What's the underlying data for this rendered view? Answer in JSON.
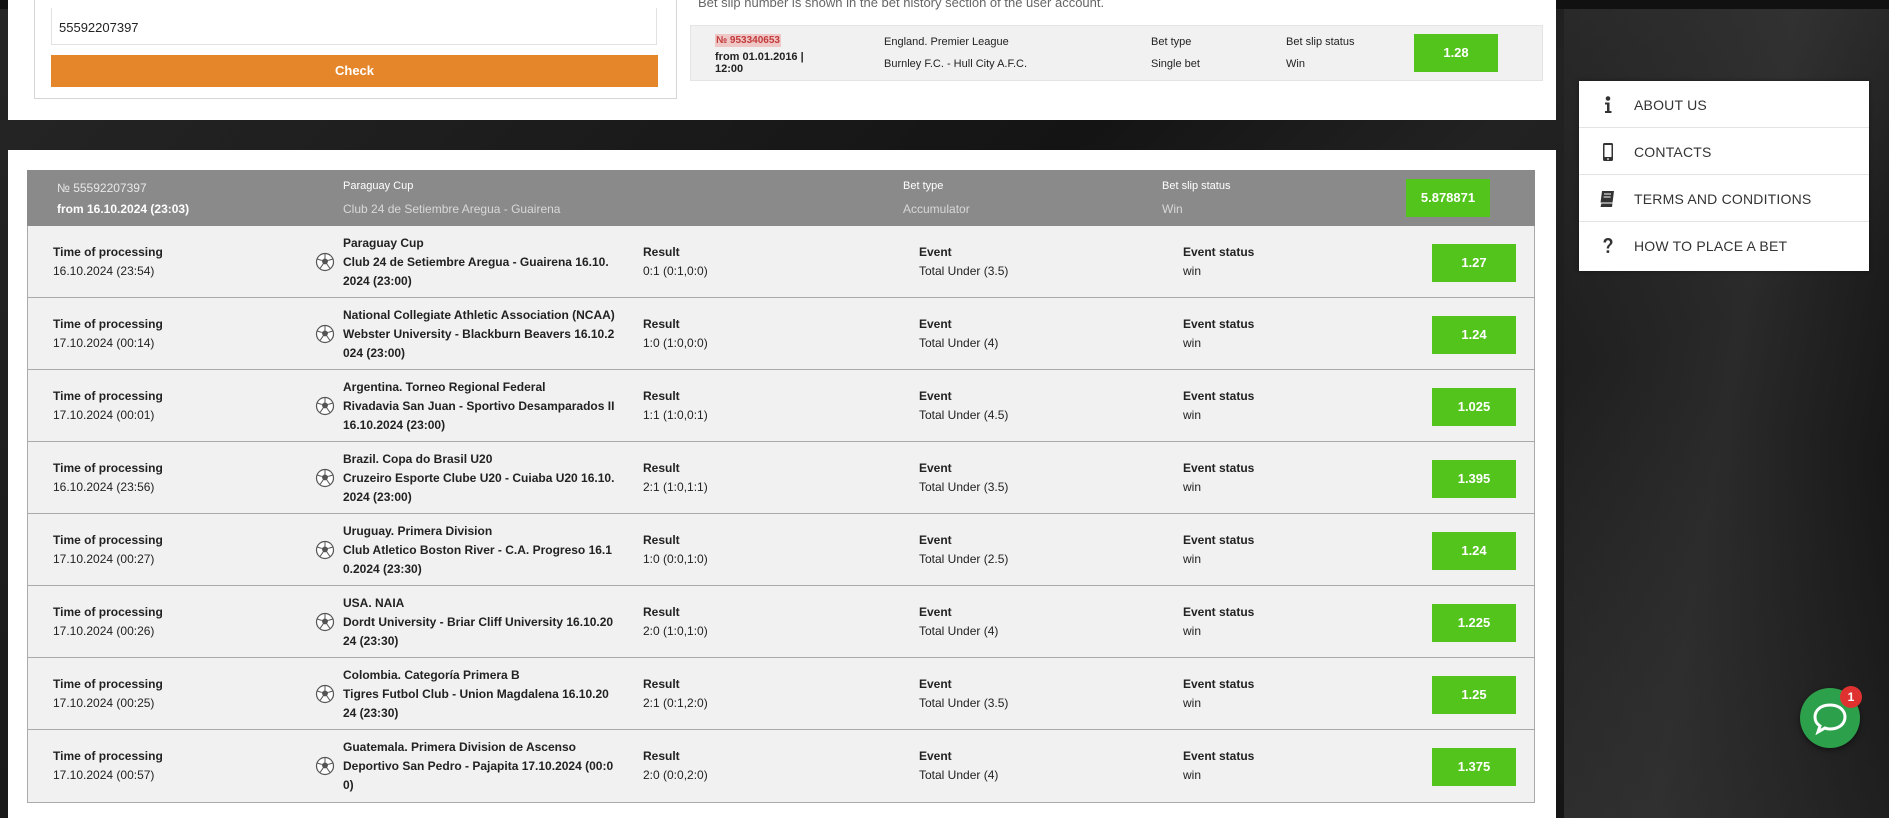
{
  "check": {
    "input_value": "55592207397",
    "button_label": "Check"
  },
  "hint": "Bet slip number is shown in the bet history section of the user account.",
  "prev_slip": {
    "number": "№ 953340653",
    "date": "from 01.01.2016 | 12:00",
    "league": "England. Premier League",
    "match": "Burnley F.C. - Hull City A.F.C.",
    "bet_type_label": "Bet type",
    "bet_type": "Single bet",
    "status_label": "Bet slip status",
    "status": "Win",
    "odds": "1.28"
  },
  "slip": {
    "number": "№ 55592207397",
    "date": "from 16.10.2024 (23:03)",
    "tournament": "Paraguay Cup",
    "match": "Club 24 de Setiembre Aregua - Guairena",
    "bet_type_label": "Bet type",
    "bet_type": "Accumulator",
    "status_label": "Bet slip status",
    "status": "Win",
    "odds": "5.878871"
  },
  "labels": {
    "time": "Time of processing",
    "result": "Result",
    "event": "Event",
    "event_status": "Event status"
  },
  "events": [
    {
      "time": "16.10.2024 (23:54)",
      "tournament": "Paraguay Cup",
      "match": "Club 24 de Setiembre Aregua - Guairena 16.10.2024 (23:00)",
      "result": "0:1 (0:1,0:0)",
      "event": "Total Under (3.5)",
      "status": "win",
      "odds": "1.27"
    },
    {
      "time": "17.10.2024 (00:14)",
      "tournament": "National Collegiate Athletic Association (NCAA)",
      "match": "Webster University - Blackburn Beavers 16.10.2024 (23:00)",
      "result": "1:0 (1:0,0:0)",
      "event": "Total Under (4)",
      "status": "win",
      "odds": "1.24"
    },
    {
      "time": "17.10.2024 (00:01)",
      "tournament": "Argentina. Torneo Regional Federal",
      "match": "Rivadavia San Juan - Sportivo Desamparados II 16.10.2024 (23:00)",
      "result": "1:1 (1:0,0:1)",
      "event": "Total Under (4.5)",
      "status": "win",
      "odds": "1.025"
    },
    {
      "time": "16.10.2024 (23:56)",
      "tournament": "Brazil. Copa do Brasil U20",
      "match": "Cruzeiro Esporte Clube U20 - Cuiaba U20 16.10.2024 (23:00)",
      "result": "2:1 (1:0,1:1)",
      "event": "Total Under (3.5)",
      "status": "win",
      "odds": "1.395"
    },
    {
      "time": "17.10.2024 (00:27)",
      "tournament": "Uruguay. Primera Division",
      "match": "Club Atletico Boston River - C.A. Progreso 16.10.2024 (23:30)",
      "result": "1:0 (0:0,1:0)",
      "event": "Total Under (2.5)",
      "status": "win",
      "odds": "1.24"
    },
    {
      "time": "17.10.2024 (00:26)",
      "tournament": "USA. NAIA",
      "match": "Dordt University - Briar Cliff University 16.10.2024 (23:30)",
      "result": "2:0 (1:0,1:0)",
      "event": "Total Under (4)",
      "status": "win",
      "odds": "1.225"
    },
    {
      "time": "17.10.2024 (00:25)",
      "tournament": "Colombia. Categoría Primera B",
      "match": "Tigres Futbol Club - Union Magdalena 16.10.2024 (23:30)",
      "result": "2:1 (0:1,2:0)",
      "event": "Total Under (3.5)",
      "status": "win",
      "odds": "1.25"
    },
    {
      "time": "17.10.2024 (00:57)",
      "tournament": "Guatemala. Primera Division de Ascenso",
      "match": "Deportivo San Pedro - Pajapita 17.10.2024 (00:00)",
      "result": "2:0 (0:0,2:0)",
      "event": "Total Under (4)",
      "status": "win",
      "odds": "1.375"
    }
  ],
  "menu": [
    {
      "label": "ABOUT US",
      "icon": "info-icon"
    },
    {
      "label": "CONTACTS",
      "icon": "phone-icon"
    },
    {
      "label": "TERMS AND CONDITIONS",
      "icon": "book-icon"
    },
    {
      "label": "HOW TO PLACE A BET",
      "icon": "question-icon"
    }
  ],
  "chat": {
    "badge": "1"
  },
  "colors": {
    "accent": "#e6862a",
    "odds_green": "#53c41b",
    "header_gray": "#8a8a8a"
  }
}
